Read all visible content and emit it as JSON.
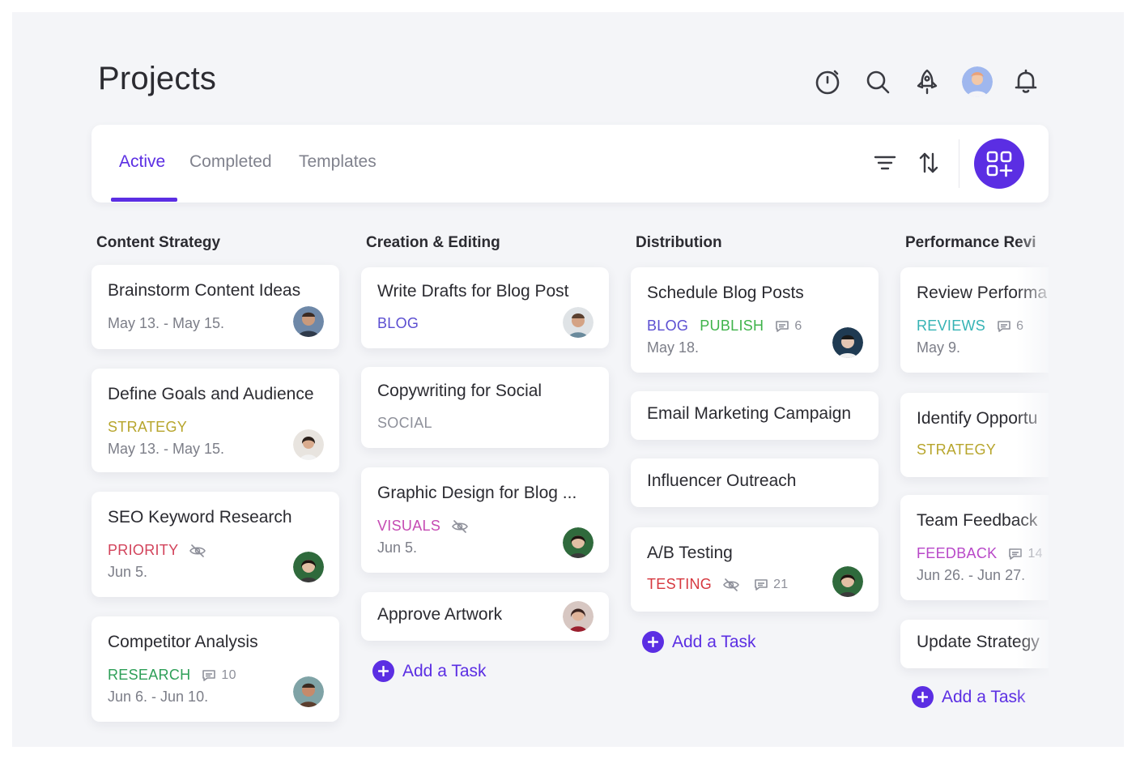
{
  "header": {
    "title": "Projects",
    "icons": [
      "timer-icon",
      "search-icon",
      "rocket-icon",
      "avatar",
      "bell-icon"
    ]
  },
  "tabs": [
    {
      "label": "Active",
      "active": true
    },
    {
      "label": "Completed",
      "active": false
    },
    {
      "label": "Templates",
      "active": false
    }
  ],
  "toolbar": {
    "icons": [
      "filter-icon",
      "sort-icon",
      "add-board-icon"
    ]
  },
  "colors": {
    "accent": "#5b2ee3",
    "tag_blog": "#5b4ed1",
    "tag_publish": "#3fb34a",
    "tag_strategy": "#b7a52c",
    "tag_priority": "#d2435b",
    "tag_research": "#2e9f58",
    "tag_social": "#8e909a",
    "tag_visuals": "#c54bb3",
    "tag_testing": "#d6383f",
    "tag_reviews": "#36b3b5",
    "tag_feedback": "#b848c8"
  },
  "columns": [
    {
      "title": "Content Strategy",
      "add_label": "",
      "cards": [
        {
          "title": "Brainstorm Content Ideas",
          "date": "May 13. - May 15."
        },
        {
          "title": "Define Goals and Audience",
          "tag": "STRATEGY",
          "date": "May 13. - May 15."
        },
        {
          "title": "SEO Keyword Research",
          "tag": "PRIORITY",
          "date": "Jun 5."
        },
        {
          "title": "Competitor Analysis",
          "tag": "RESEARCH",
          "comments": "10",
          "date": "Jun 6. - Jun 10."
        }
      ]
    },
    {
      "title": "Creation & Editing",
      "add_label": "Add a Task",
      "cards": [
        {
          "title": "Write Drafts for Blog Post",
          "tag": "BLOG"
        },
        {
          "title": "Copywriting for Social",
          "tag": "SOCIAL"
        },
        {
          "title": "Graphic Design for Blog ...",
          "tag": "VISUALS",
          "date": "Jun 5."
        },
        {
          "title": "Approve Artwork"
        }
      ]
    },
    {
      "title": "Distribution",
      "add_label": "Add a Task",
      "cards": [
        {
          "title": "Schedule Blog Posts",
          "tag": "BLOG",
          "tag2": "PUBLISH",
          "comments": "6",
          "date": "May 18."
        },
        {
          "title": "Email Marketing Campaign"
        },
        {
          "title": "Influencer Outreach"
        },
        {
          "title": "A/B Testing",
          "tag": "TESTING",
          "comments": "21"
        }
      ]
    },
    {
      "title": "Performance Revi",
      "add_label": "Add a Task",
      "cards": [
        {
          "title": "Review Performa",
          "tag": "REVIEWS",
          "comments": "6",
          "date": "May 9."
        },
        {
          "title": "Identify Opportu",
          "tag": "STRATEGY"
        },
        {
          "title": "Team Feedback",
          "tag": "FEEDBACK",
          "comments": "14",
          "date": "Jun 26. - Jun 27."
        },
        {
          "title": "Update Strategy"
        }
      ]
    }
  ]
}
